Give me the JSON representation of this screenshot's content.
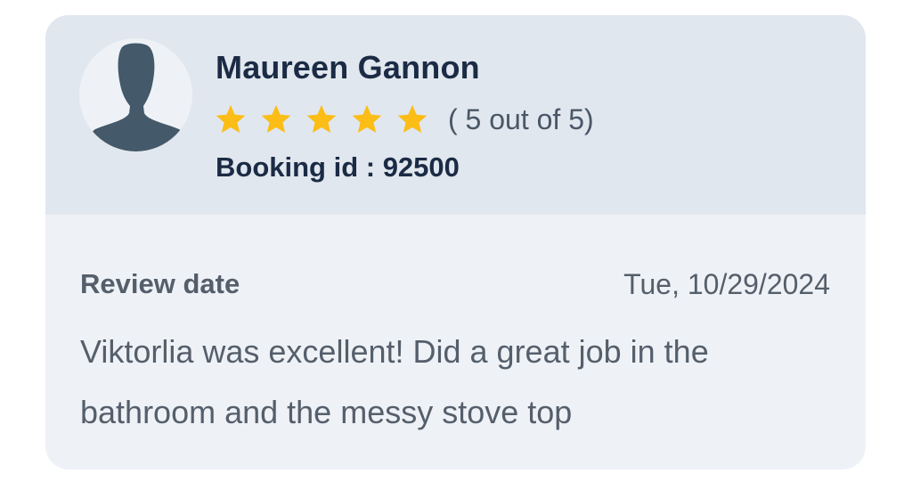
{
  "review": {
    "reviewer_name": "Maureen Gannon",
    "avatar_icon": "user-silhouette-icon",
    "rating": 5,
    "rating_max": 5,
    "rating_text": "( 5 out of 5)",
    "booking_text": "Booking id : 92500",
    "review_date_label": "Review date",
    "review_date_value": "Tue, 10/29/2024",
    "review_text": "Viktorlia was excellent! Did a great job in the bathroom and the messy stove top"
  },
  "colors": {
    "card_background": "#eef2f7",
    "header_background": "#e1e7ee",
    "star": "#fbbd16",
    "name_text": "#1b2b45",
    "body_text": "#555f6b",
    "avatar_figure": "#44596a"
  }
}
